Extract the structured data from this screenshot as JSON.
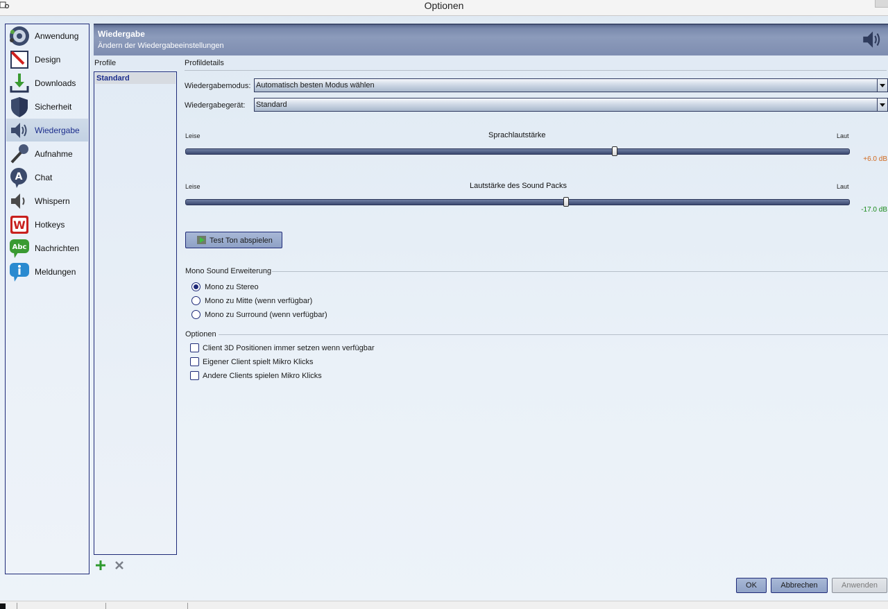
{
  "window": {
    "title": "Optionen"
  },
  "sidebar": {
    "items": [
      {
        "label": "Anwendung",
        "icon": "teamspeak-icon"
      },
      {
        "label": "Design",
        "icon": "design-icon"
      },
      {
        "label": "Downloads",
        "icon": "download-icon"
      },
      {
        "label": "Sicherheit",
        "icon": "shield-icon"
      },
      {
        "label": "Wiedergabe",
        "icon": "speaker-icon",
        "selected": true
      },
      {
        "label": "Aufnahme",
        "icon": "microphone-icon"
      },
      {
        "label": "Chat",
        "icon": "chat-icon"
      },
      {
        "label": "Whispern",
        "icon": "whisper-icon"
      },
      {
        "label": "Hotkeys",
        "icon": "hotkeys-icon"
      },
      {
        "label": "Nachrichten",
        "icon": "messages-icon"
      },
      {
        "label": "Meldungen",
        "icon": "info-icon"
      }
    ]
  },
  "header": {
    "title": "Wiedergabe",
    "subtitle": "Ändern der Wiedergabeeinstellungen",
    "icon": "speaker-icon"
  },
  "profiles": {
    "label": "Profile",
    "items": [
      "Standard"
    ],
    "selected": "Standard",
    "add_icon": "plus-icon",
    "delete_icon": "x-icon"
  },
  "details": {
    "label": "Profildetails",
    "mode_label": "Wiedergabemodus:",
    "mode_value": "Automatisch besten Modus wählen",
    "device_label": "Wiedergabegerät:",
    "device_value": "Standard",
    "voice_slider": {
      "title": "Sprachlautstärke",
      "min_label": "Leise",
      "max_label": "Laut",
      "value_text": "+6.0 dB",
      "value_color": "#d2691e",
      "position_fraction": 0.646
    },
    "soundpack_slider": {
      "title": "Lautstärke des Sound Packs",
      "min_label": "Leise",
      "max_label": "Laut",
      "value_text": "-17.0 dB",
      "value_color": "#1a8a1a",
      "position_fraction": 0.573
    },
    "test_button": "Test Ton abspielen"
  },
  "mono": {
    "title": "Mono Sound Erweiterung",
    "options": [
      {
        "label": "Mono zu Stereo",
        "checked": true
      },
      {
        "label": "Mono zu Mitte (wenn verfügbar)",
        "checked": false
      },
      {
        "label": "Mono zu Surround (wenn verfügbar)",
        "checked": false
      }
    ]
  },
  "options": {
    "title": "Optionen",
    "checks": [
      {
        "label": "Client 3D Positionen immer setzen wenn verfügbar",
        "checked": false
      },
      {
        "label": "Eigener Client spielt Mikro Klicks",
        "checked": false
      },
      {
        "label": "Andere Clients spielen Mikro Klicks",
        "checked": false
      }
    ]
  },
  "buttons": {
    "ok": "OK",
    "cancel": "Abbrechen",
    "apply": "Anwenden",
    "apply_enabled": false
  }
}
